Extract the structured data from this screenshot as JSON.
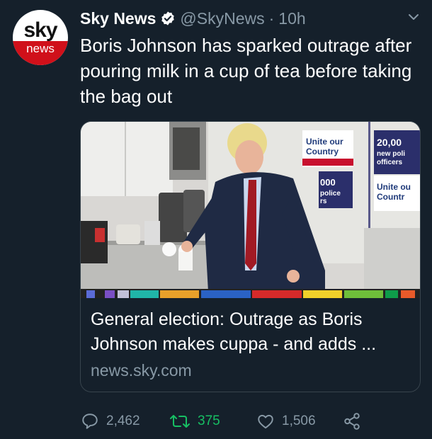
{
  "account": {
    "display_name": "Sky News",
    "handle": "@SkyNews",
    "separator": "·",
    "time_ago": "10h",
    "avatar": {
      "logo_top": "sky",
      "logo_bottom": "news"
    }
  },
  "tweet": {
    "text": "Boris Johnson has sparked outrage after pouring milk in a cup of tea before taking the bag out"
  },
  "card": {
    "title": "General election: Outrage as Boris Johnson makes cuppa - and adds ...",
    "domain": "news.sky.com",
    "image": {
      "poster_1": "Unite our Country",
      "poster_2": "20,00 new poli officers",
      "poster_3": "000 police rs",
      "poster_4": "Unite ou Countr"
    }
  },
  "actions": {
    "replies": "2,462",
    "retweets": "375",
    "likes": "1,506"
  },
  "colors": {
    "background": "#15202b",
    "muted": "#8899a6",
    "retweet_green": "#17bf63",
    "verified_blue": "#ffffff"
  }
}
